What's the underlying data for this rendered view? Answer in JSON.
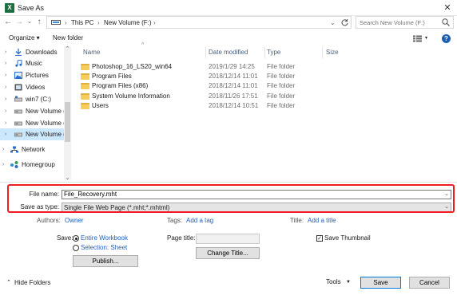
{
  "window": {
    "title": "Save As",
    "app_icon_letter": "X",
    "close_glyph": "✕"
  },
  "address": {
    "segments": [
      "This PC",
      "New Volume (F:)"
    ],
    "search_placeholder": "Search New Volume (F:)"
  },
  "toolbar": {
    "organize_label": "Organize ▾",
    "new_folder_label": "New folder"
  },
  "sidebar": {
    "items": [
      {
        "label": "Downloads",
        "icon": "download-icon"
      },
      {
        "label": "Music",
        "icon": "music-icon"
      },
      {
        "label": "Pictures",
        "icon": "pictures-icon"
      },
      {
        "label": "Videos",
        "icon": "videos-icon"
      },
      {
        "label": "win7 (C:)",
        "icon": "drive-icon"
      },
      {
        "label": "New Volume (I",
        "icon": "drive-icon"
      },
      {
        "label": "New Volume (I",
        "icon": "drive-icon"
      },
      {
        "label": "New Volume (I",
        "icon": "drive-icon",
        "selected": true
      },
      {
        "label": "Network",
        "icon": "network-icon"
      },
      {
        "label": "Homegroup",
        "icon": "homegroup-icon"
      }
    ]
  },
  "file_list": {
    "columns": [
      "Name",
      "Date modified",
      "Type",
      "Size"
    ],
    "rows": [
      {
        "name": "Photoshop_16_LS20_win64",
        "date": "2019/1/29 14:25",
        "type": "File folder"
      },
      {
        "name": "Program Files",
        "date": "2018/12/14 11:01",
        "type": "File folder"
      },
      {
        "name": "Program Files (x86)",
        "date": "2018/12/14 11:01",
        "type": "File folder"
      },
      {
        "name": "System Volume Information",
        "date": "2018/11/26 17:51",
        "type": "File folder"
      },
      {
        "name": "Users",
        "date": "2018/12/14 10:51",
        "type": "File folder"
      }
    ]
  },
  "save_fields": {
    "file_name_label": "File name:",
    "file_name_value": "File_Recovery.mht",
    "save_type_label": "Save as type:",
    "save_type_value": "Single File Web Page (*.mht;*.mhtml)"
  },
  "meta": {
    "authors_label": "Authors:",
    "authors_value": "Owner",
    "tags_label": "Tags:",
    "tags_value": "Add a tag",
    "title_label": "Title:",
    "title_value": "Add a title"
  },
  "options": {
    "save_label": "Save:",
    "entire_workbook": "Entire Workbook",
    "selection_sheet": "Selection: Sheet",
    "publish_label": "Publish...",
    "page_title_label": "Page title:",
    "change_title_label": "Change Title...",
    "save_thumbnail_label": "Save Thumbnail"
  },
  "footer": {
    "hide_folders_label": "Hide Folders",
    "tools_label": "Tools",
    "save_label": "Save",
    "cancel_label": "Cancel"
  }
}
